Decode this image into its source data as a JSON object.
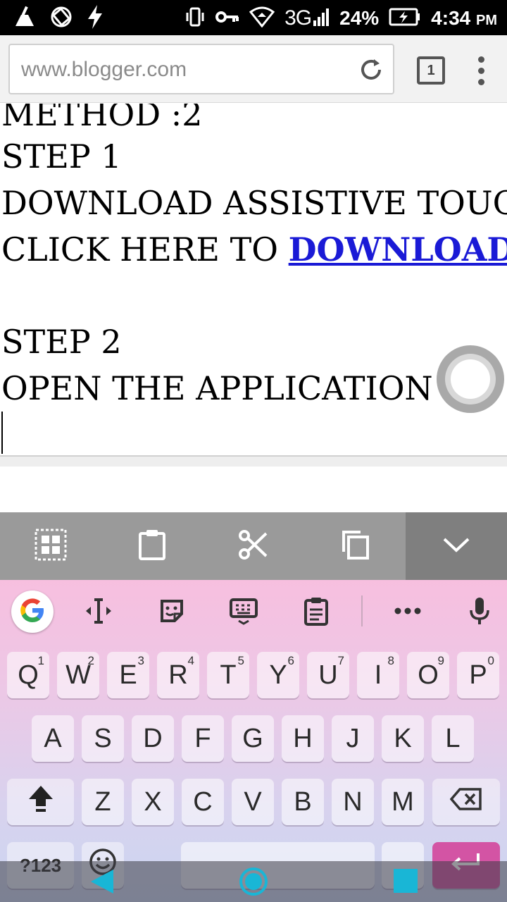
{
  "status_bar": {
    "network": "3G",
    "battery": "24%",
    "time": "4:34",
    "ampm": "PM",
    "icons": [
      "cleaner-icon",
      "sync-icon",
      "flash-icon",
      "vibrate-icon",
      "vpn-key-icon",
      "wifi-icon",
      "signal-icon",
      "battery-charging-icon"
    ]
  },
  "browser": {
    "url": "www.blogger.com",
    "tab_count": "1"
  },
  "content": {
    "lines": [
      "METHOD :2",
      "STEP 1",
      "DOWNLOAD ASSISTIVE TOUCH",
      "CLICK HERE TO ",
      "STEP 2",
      "OPEN THE APPLICATION"
    ],
    "link_text": "DOWNLOAD"
  },
  "clipboard_bar": {
    "actions": [
      "select-all",
      "paste",
      "cut",
      "copy",
      "hide"
    ]
  },
  "keyboard": {
    "row1": [
      {
        "k": "Q",
        "s": "1"
      },
      {
        "k": "W",
        "s": "2"
      },
      {
        "k": "E",
        "s": "3"
      },
      {
        "k": "R",
        "s": "4"
      },
      {
        "k": "T",
        "s": "5"
      },
      {
        "k": "Y",
        "s": "6"
      },
      {
        "k": "U",
        "s": "7"
      },
      {
        "k": "I",
        "s": "8"
      },
      {
        "k": "O",
        "s": "9"
      },
      {
        "k": "P",
        "s": "0"
      }
    ],
    "row2": [
      "A",
      "S",
      "D",
      "F",
      "G",
      "H",
      "J",
      "K",
      "L"
    ],
    "row3": [
      "Z",
      "X",
      "C",
      "V",
      "B",
      "N",
      "M"
    ],
    "symbols_label": "?123",
    "accent_color": "#d354a4"
  }
}
